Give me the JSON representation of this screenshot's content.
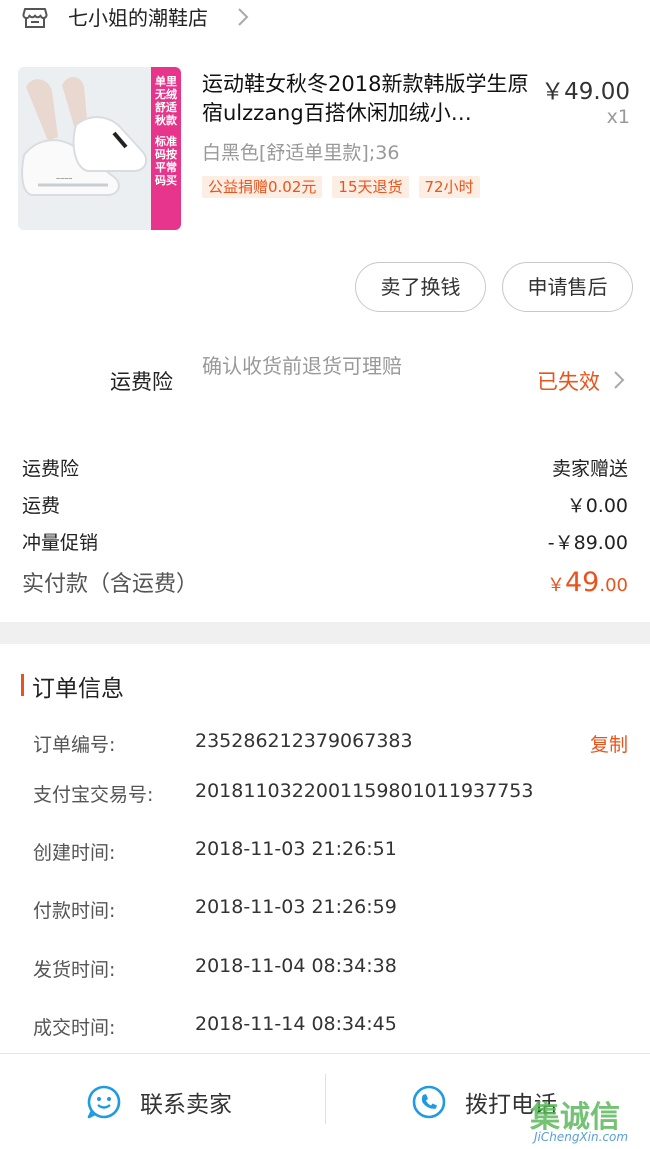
{
  "shop": {
    "name": "七小姐的潮鞋店",
    "icon": "store-icon"
  },
  "product": {
    "title": "运动鞋女秋冬2018新款韩版学生原宿ulzzang百搭休闲加绒小…",
    "price": "￥49.00",
    "quantity": "x1",
    "sku": "白黑色[舒适单里款];36",
    "image_badges": [
      "单里",
      "无绒",
      "舒适",
      "秋款",
      "标准",
      "码按",
      "平常",
      "码买"
    ],
    "tags": [
      "公益捐赠0.02元",
      "15天退货",
      "72小时"
    ]
  },
  "actions": {
    "sell": "卖了换钱",
    "after_sale": "申请售后"
  },
  "insurance": {
    "label": "运费险",
    "description": "确认收货前退货可理赔",
    "status": "已失效"
  },
  "fees": [
    {
      "label": "运费险",
      "value": "卖家赠送"
    },
    {
      "label": "运费",
      "value": "￥0.00"
    },
    {
      "label": "冲量促销",
      "value": "-￥89.00"
    }
  ],
  "total": {
    "label": "实付款（含运费）",
    "currency": "￥",
    "integer": "49",
    "decimal": ".00"
  },
  "order_info": {
    "title": "订单信息",
    "copy_label": "复制",
    "rows": [
      {
        "label": "订单编号:",
        "value": "235286212379067383"
      },
      {
        "label": "支付宝交易号:",
        "value": "2018110322001159801011937753"
      },
      {
        "label": "创建时间:",
        "value": "2018-11-03 21:26:51"
      },
      {
        "label": "付款时间:",
        "value": "2018-11-03 21:26:59"
      },
      {
        "label": "发货时间:",
        "value": "2018-11-04 08:34:38"
      },
      {
        "label": "成交时间:",
        "value": "2018-11-14 08:34:45"
      }
    ]
  },
  "bottom_bar": {
    "contact_seller": "联系卖家",
    "call_phone": "拨打电话"
  },
  "watermark": {
    "text": "集诚信",
    "sub": "JiChengXin.com"
  },
  "colors": {
    "accent": "#e8541e",
    "icon_blue": "#1f9be0",
    "tag_bg": "#fdeee4"
  }
}
